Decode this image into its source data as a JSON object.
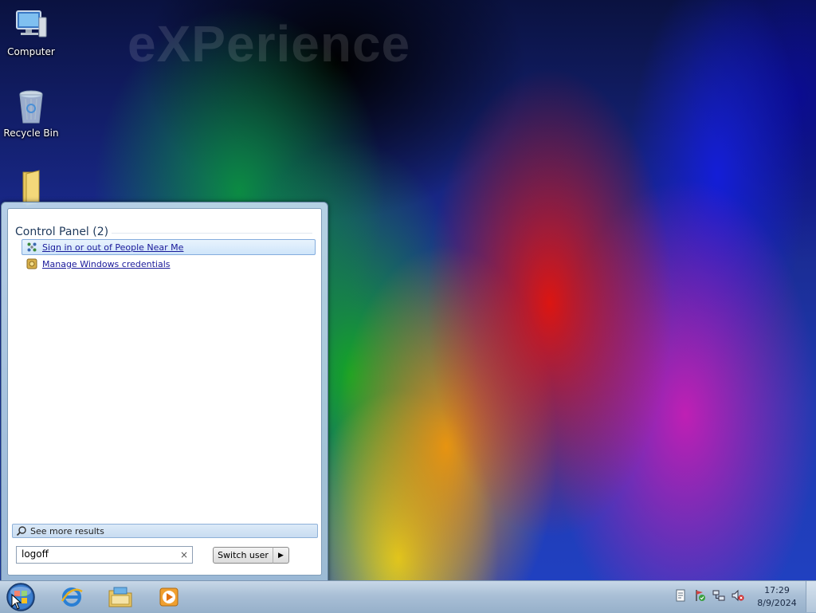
{
  "desktop": {
    "watermark": "eXPerience",
    "icons": [
      {
        "label": "Computer",
        "icon": "computer-icon"
      },
      {
        "label": "Recycle Bin",
        "icon": "recycle-bin-icon"
      },
      {
        "label": "",
        "icon": "folder-icon"
      }
    ]
  },
  "start_menu": {
    "results_header": "Control Panel (2)",
    "results": [
      {
        "label": "Sign in or out of People Near Me",
        "icon": "people-near-me-icon",
        "selected": true
      },
      {
        "label": "Manage Windows credentials",
        "icon": "credential-manager-icon",
        "selected": false
      }
    ],
    "see_more_label": "See more results",
    "search_value": "logoff",
    "clear_glyph": "×",
    "switch_user_label": "Switch user",
    "switch_arrow_glyph": "▶"
  },
  "taskbar": {
    "pinned": [
      {
        "name": "internet-explorer-icon"
      },
      {
        "name": "windows-explorer-icon"
      },
      {
        "name": "media-player-icon"
      }
    ],
    "tray": {
      "time": "17:29",
      "date": "8/9/2024",
      "icons": [
        "notes-icon",
        "action-center-icon",
        "network-icon",
        "volume-muted-icon"
      ]
    }
  },
  "colors": {
    "link": "#1a1a9a",
    "selected_bg": "#cfe5fa",
    "taskbar": "#a9bfd6"
  }
}
